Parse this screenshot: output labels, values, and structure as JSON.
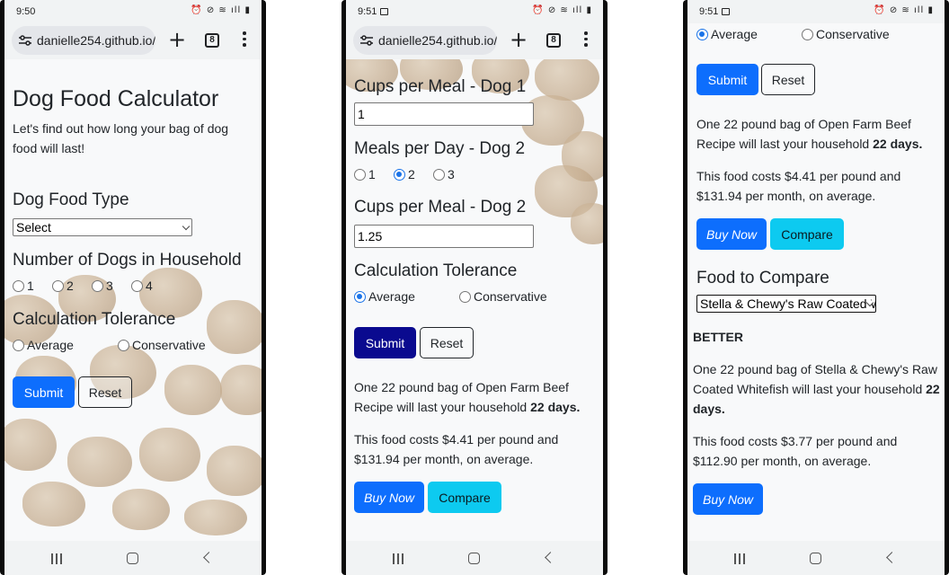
{
  "status_bar": {
    "time_1": "9:50",
    "time_2": "9:51",
    "time_3": "9:51",
    "icons": "⏰ ⊘ ≋ ıll ▮"
  },
  "browser": {
    "url": "danielle254.github.io/",
    "tab_count": "8"
  },
  "screen1": {
    "title": "Dog Food Calculator",
    "intro": "Let's find out how long your bag of dog food will last!",
    "food_type_heading": "Dog Food Type",
    "food_select_value": "Select",
    "dogs_heading": "Number of Dogs in Household",
    "dog_options": [
      "1",
      "2",
      "3",
      "4"
    ],
    "tolerance_heading": "Calculation Tolerance",
    "tolerance_options": [
      "Average",
      "Conservative"
    ],
    "submit_label": "Submit",
    "reset_label": "Reset"
  },
  "screen2": {
    "cups_dog1_heading": "Cups per Meal - Dog 1",
    "cups_dog1_value": "1",
    "meals_dog2_heading": "Meals per Day - Dog 2",
    "meal_options": [
      "1",
      "2",
      "3"
    ],
    "meals_selected": "2",
    "cups_dog2_heading": "Cups per Meal - Dog 2",
    "cups_dog2_value": "1.25",
    "tolerance_heading": "Calculation Tolerance",
    "tolerance_options": [
      "Average",
      "Conservative"
    ],
    "tolerance_selected": "Average",
    "submit_label": "Submit",
    "reset_label": "Reset",
    "result_text": "One 22 pound bag of Open Farm Beef Recipe will last your household",
    "result_days": "22 days.",
    "cost_text": "This food costs $4.41 per pound and $131.94 per month, on average.",
    "buy_label": "Buy Now",
    "compare_label": "Compare"
  },
  "screen3": {
    "tolerance_options": [
      "Average",
      "Conservative"
    ],
    "tolerance_selected": "Average",
    "submit_label": "Submit",
    "reset_label": "Reset",
    "result_text": "One 22 pound bag of Open Farm Beef Recipe will last your household",
    "result_days": "22 days.",
    "cost_text": "This food costs $4.41 per pound and $131.94 per month, on average.",
    "buy_label": "Buy Now",
    "compare_label": "Compare",
    "compare_heading": "Food to Compare",
    "compare_select_value": "Stella & Chewy's Raw Coated Whitefish",
    "verdict": "BETTER",
    "compare_result_text": "One 22 pound bag of Stella & Chewy's Raw Coated Whitefish will last your household",
    "compare_result_days": "22 days.",
    "compare_cost_text": "This food costs $3.77 per pound and $112.90 per month, on average.",
    "compare_buy_label": "Buy Now"
  },
  "colors": {
    "primary": "#0d6efd",
    "primary_active": "#0a0a8f",
    "info": "#0dcaf0",
    "radio_selected": "#1a73e8"
  }
}
